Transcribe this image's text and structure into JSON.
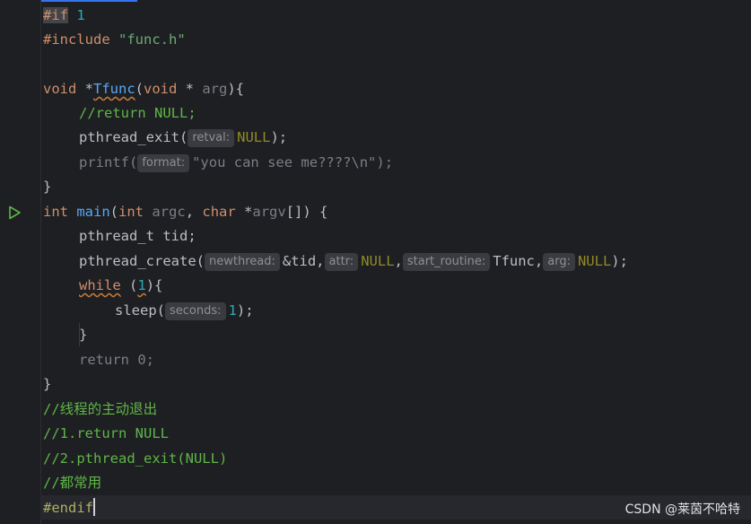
{
  "editor": {
    "lines": {
      "l1_kw": "#if",
      "l1_num": "1",
      "l2_kw": "#include",
      "l2_str": "\"func.h\"",
      "l4_type": "void",
      "l4_star": " *",
      "l4_fn": "Tfunc",
      "l4_open": "(",
      "l4_kw2": "void",
      "l4_rest": " * ",
      "l4_param": "arg",
      "l4_close": "){",
      "l5_cmt": "//return NULL;",
      "l6_fn": "pthread_exit(",
      "l6_hint": "retval:",
      "l6_arg": "NULL",
      "l6_end": ");",
      "l7_fn": "printf(",
      "l7_hint": "format:",
      "l7_arg": "\"you can see me????\\n\");",
      "l8": "}",
      "l9_kw": "int",
      "l9_fn": "main",
      "l9_open": "(",
      "l9_kw2": "int",
      "l9_p1": " argc",
      "l9_comma": ", ",
      "l9_kw3": "char",
      "l9_star": " *",
      "l9_p2": "argv",
      "l9_close": "[]) {",
      "l10": "pthread_t tid;",
      "l11_fn": "pthread_create(",
      "l11_h1": "newthread:",
      "l11_a1": "&tid,",
      "l11_h2": "attr:",
      "l11_a2": "NULL",
      "l11_c2": ",",
      "l11_h3": "start_routine:",
      "l11_a3": "Tfunc,",
      "l11_h4": "arg:",
      "l11_a4": "NULL",
      "l11_end": ");",
      "l12_kw": "while",
      "l12_sp": " (",
      "l12_num": "1",
      "l12_end": "){",
      "l13_fn": "sleep(",
      "l13_hint": "seconds:",
      "l13_num": "1",
      "l13_end": ");",
      "l14": "}",
      "l15": "return 0;",
      "l16": "}",
      "l17_cmt": "//线程的主动退出",
      "l18_cmt": "//1.return NULL",
      "l19_cmt": "//2.pthread_exit(NULL)",
      "l20_cmt": "//都常用",
      "l21_kw": "#endif"
    },
    "run_icon": "run-triangle-icon"
  },
  "watermark": "CSDN @莱茵不哈特",
  "colors": {
    "background": "#1e1f22",
    "keyword": "#cf8e6d",
    "function": "#56a8f5",
    "comment": "#5fb548",
    "number": "#2aacb8"
  }
}
